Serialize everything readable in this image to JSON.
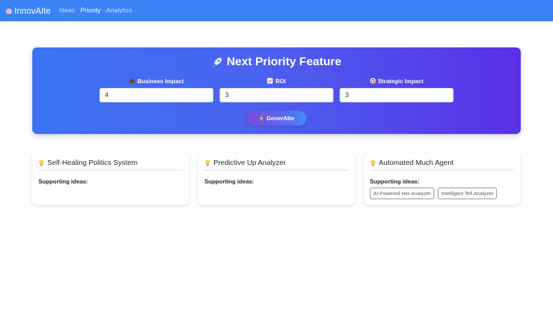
{
  "nav": {
    "brand": "InnovAIte",
    "links": [
      "Ideas",
      "Priority",
      "Analytics"
    ],
    "active": "Priority"
  },
  "hero": {
    "title": "Next Priority Feature",
    "fields": [
      {
        "label": "Business Impact",
        "icon": "briefcase-icon",
        "value": "4"
      },
      {
        "label": "ROI",
        "icon": "chart-icon",
        "value": "3"
      },
      {
        "label": "Strategic Impact",
        "icon": "target-icon",
        "value": "3"
      }
    ],
    "button": "GenerAIte"
  },
  "cards": [
    {
      "title": "Self-Healing Politics System",
      "support_label": "Supporting ideas:",
      "tags": []
    },
    {
      "title": "Predictive Up Analyzer",
      "support_label": "Supporting ideas:",
      "tags": []
    },
    {
      "title": "Automated Much Agent",
      "support_label": "Supporting ideas:",
      "tags": [
        "AI-Powered Her Analyzer",
        "Intelligent Tell Analyzer"
      ]
    }
  ],
  "colors": {
    "navbar": "#3b82f6",
    "hero_start": "#3b73f4",
    "hero_end": "#5a2fe6"
  }
}
